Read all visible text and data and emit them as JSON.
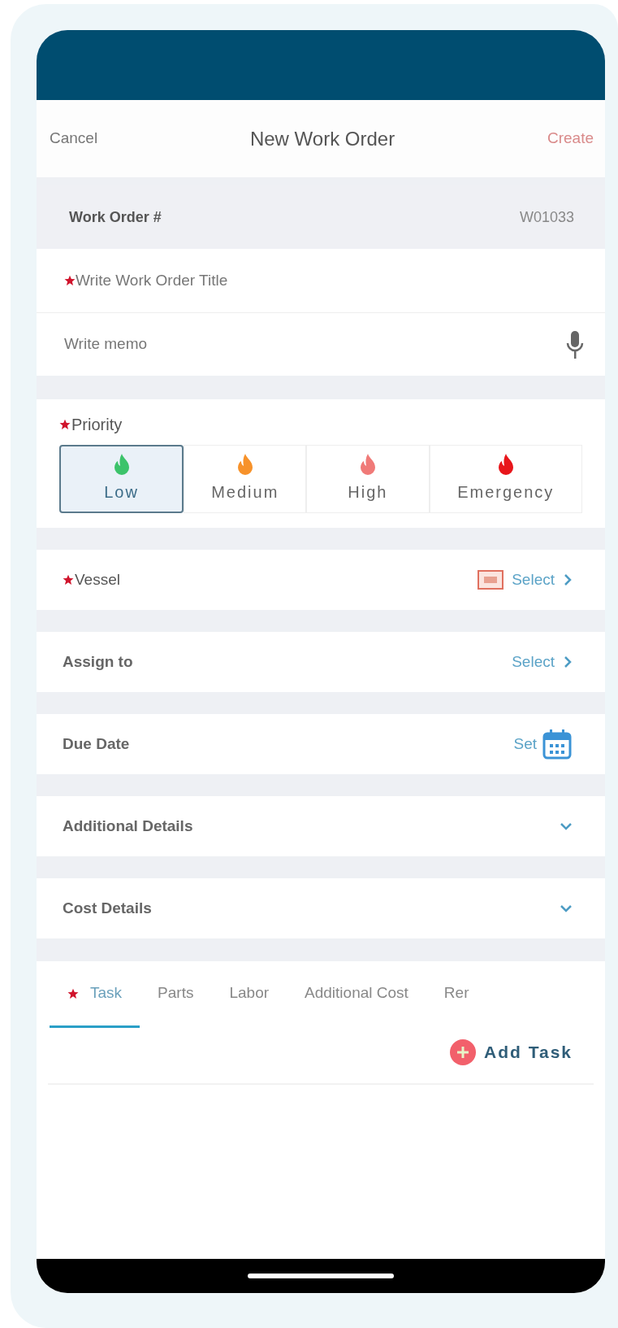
{
  "nav": {
    "cancel": "Cancel",
    "title": "New Work Order",
    "create": "Create"
  },
  "work_order": {
    "label": "Work Order #",
    "value": "W01033"
  },
  "title_field": {
    "placeholder": "Write Work Order Title",
    "required": true
  },
  "memo_field": {
    "placeholder": "Write memo"
  },
  "priority": {
    "label": "Priority",
    "required": true,
    "options": [
      {
        "label": "Low",
        "color": "#3cc36a",
        "selected": true
      },
      {
        "label": "Medium",
        "color": "#f7922a",
        "selected": false
      },
      {
        "label": "High",
        "color": "#f07a78",
        "selected": false
      },
      {
        "label": "Emergency",
        "color": "#e8161b",
        "selected": false
      }
    ]
  },
  "rows": [
    {
      "kind": "scan_select",
      "label": "Vessel",
      "required": true,
      "action": "Select"
    },
    {
      "kind": "select",
      "label": "Assign to",
      "required": false,
      "action": "Select"
    },
    {
      "kind": "date",
      "label": "Due Date",
      "required": false,
      "action": "Set"
    },
    {
      "kind": "expand",
      "label": "Additional Details",
      "required": false,
      "expanded": false
    },
    {
      "kind": "expand",
      "label": "Cost Details",
      "required": false,
      "expanded": false
    }
  ],
  "tabs": [
    {
      "label": "Task",
      "required": true,
      "selected": true
    },
    {
      "label": "Parts",
      "required": false,
      "selected": false
    },
    {
      "label": "Labor",
      "required": false,
      "selected": false
    },
    {
      "label": "Additional Cost",
      "required": false,
      "selected": false
    },
    {
      "label": "Rer",
      "required": false,
      "selected": false
    }
  ],
  "add_button": "Add Task"
}
